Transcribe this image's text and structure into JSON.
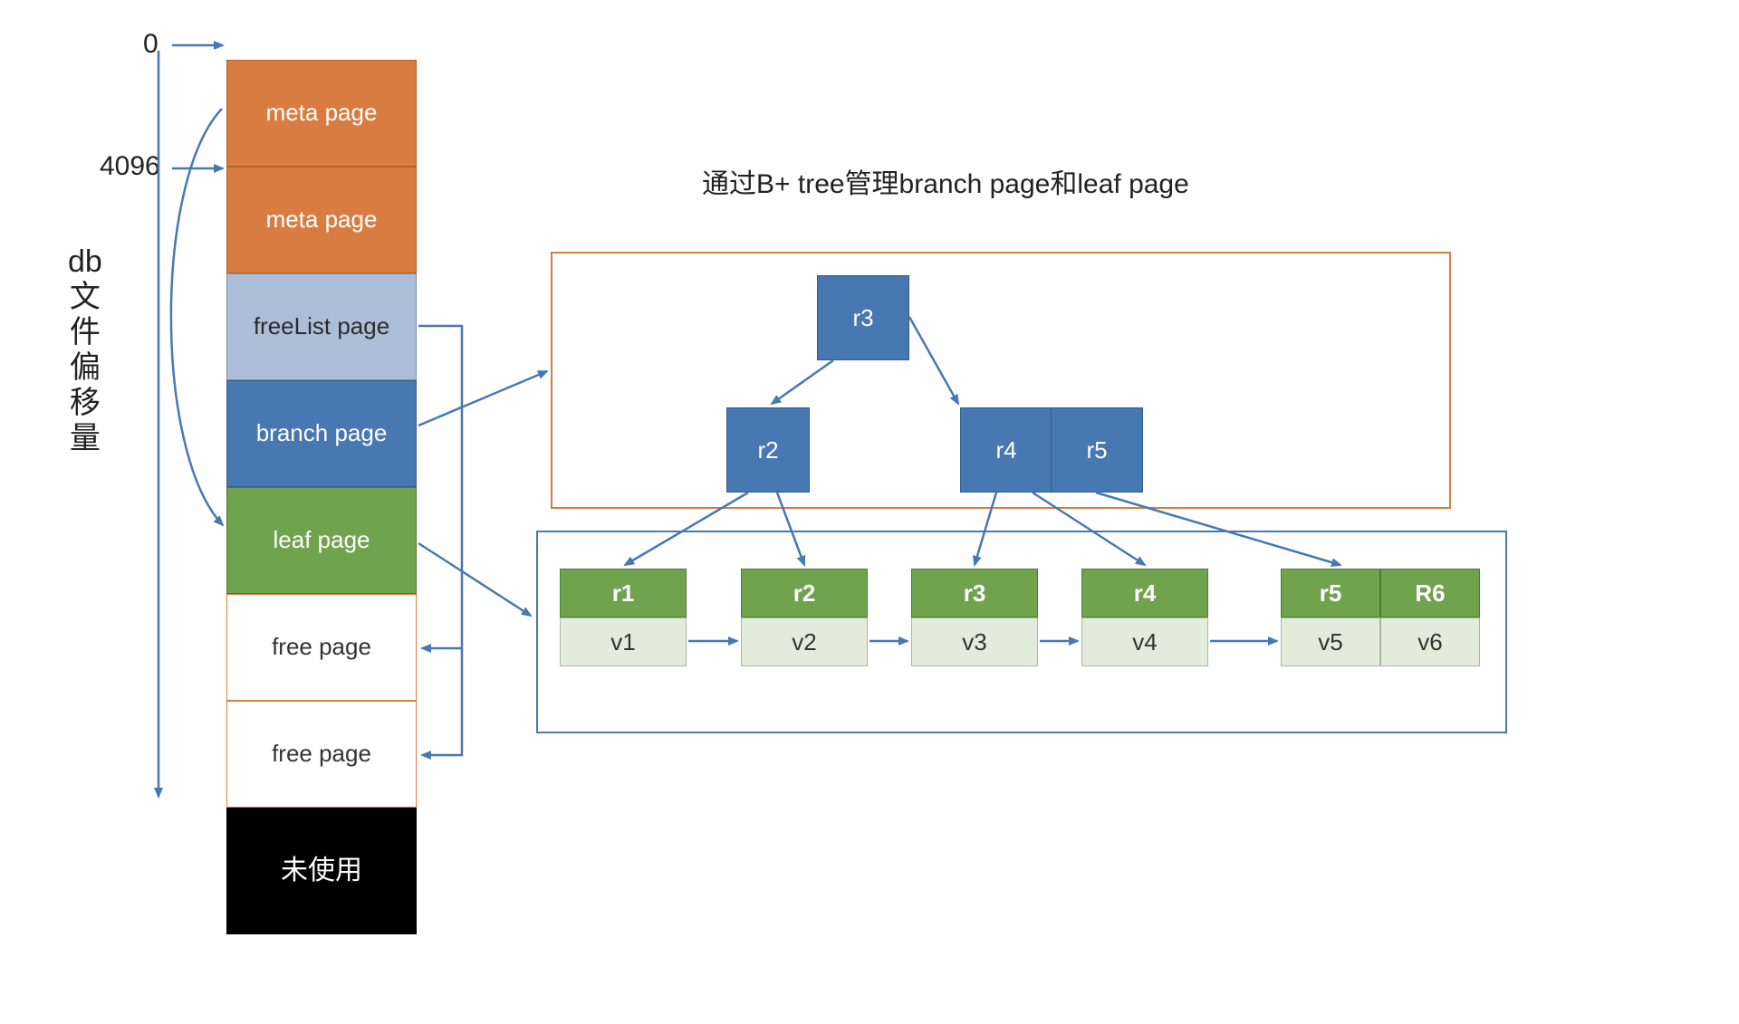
{
  "offsets": {
    "zero": "0",
    "fourk": "4096"
  },
  "vertical_label": {
    "c1": "db",
    "c2": "文",
    "c3": "件",
    "c4": "偏",
    "c5": "移",
    "c6": "量"
  },
  "pages": {
    "meta1": "meta page",
    "meta2": "meta page",
    "freelist": "freeList page",
    "branch": "branch page",
    "leaf": "leaf page",
    "free1": "free page",
    "free2": "free page",
    "unused": "未使用"
  },
  "title": "通过B+ tree管理branch page和leaf page",
  "btree": {
    "branch_root": "r3",
    "branch_left": "r2",
    "branch_right_a": "r4",
    "branch_right_b": "r5",
    "leaves": [
      {
        "k": "r1",
        "v": "v1"
      },
      {
        "k": "r2",
        "v": "v2"
      },
      {
        "k": "r3",
        "v": "v3"
      },
      {
        "k": "r4",
        "v": "v4"
      },
      {
        "k": "r5",
        "v": "v5"
      },
      {
        "k": "R6",
        "v": "v6"
      }
    ]
  }
}
